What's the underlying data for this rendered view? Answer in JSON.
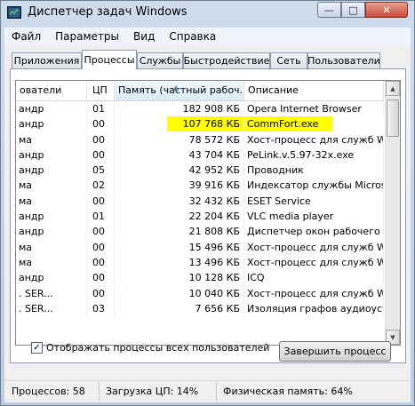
{
  "window": {
    "title": "Диспетчер задач Windows"
  },
  "caption_buttons": {
    "minimize": "—",
    "maximize": "□",
    "close": "✕"
  },
  "menu": [
    "Файл",
    "Параметры",
    "Вид",
    "Справка"
  ],
  "tabs": [
    {
      "label": "Приложения",
      "active": false
    },
    {
      "label": "Процессы",
      "active": true
    },
    {
      "label": "Службы",
      "active": false
    },
    {
      "label": "Быстродействие",
      "active": false
    },
    {
      "label": "Сеть",
      "active": false
    },
    {
      "label": "Пользователи",
      "active": false
    }
  ],
  "table": {
    "columns": {
      "user": "ователи",
      "cpu": "ЦП",
      "memory": "Память (частный рабоч...",
      "description": "Описание"
    },
    "sort_indicator": "▲",
    "rows": [
      {
        "user": "андр",
        "cpu": "01",
        "memory": "182 908 КБ",
        "description": "Opera Internet Browser",
        "highlighted": false
      },
      {
        "user": "андр",
        "cpu": "00",
        "memory": "107 768 КБ",
        "description": "CommFort.exe",
        "highlighted": true
      },
      {
        "user": "ма",
        "cpu": "00",
        "memory": "78 572 КБ",
        "description": "Хост-процесс для служб Windows",
        "highlighted": false
      },
      {
        "user": "андр",
        "cpu": "00",
        "memory": "43 704 КБ",
        "description": "PeLink.v.5.97-32x.exe",
        "highlighted": false
      },
      {
        "user": "андр",
        "cpu": "05",
        "memory": "42 952 КБ",
        "description": "Проводник",
        "highlighted": false
      },
      {
        "user": "ма",
        "cpu": "02",
        "memory": "39 916 КБ",
        "description": "Индексатор службы Microsoft Windows",
        "highlighted": false
      },
      {
        "user": "ма",
        "cpu": "00",
        "memory": "32 432 КБ",
        "description": "ESET Service",
        "highlighted": false
      },
      {
        "user": "андр",
        "cpu": "01",
        "memory": "22 204 КБ",
        "description": "VLC media player",
        "highlighted": false
      },
      {
        "user": "андр",
        "cpu": "00",
        "memory": "21 808 КБ",
        "description": "Диспетчер окон рабочего стола",
        "highlighted": false
      },
      {
        "user": "ма",
        "cpu": "00",
        "memory": "15 496 КБ",
        "description": "Хост-процесс для служб Windows",
        "highlighted": false
      },
      {
        "user": "ма",
        "cpu": "00",
        "memory": "13 496 КБ",
        "description": "Хост-процесс для служб Windows",
        "highlighted": false
      },
      {
        "user": "андр",
        "cpu": "00",
        "memory": "10 128 КБ",
        "description": "ICQ",
        "highlighted": false
      },
      {
        "user": ". SER...",
        "cpu": "00",
        "memory": "10 040 КБ",
        "description": "Хост-процесс для служб Windows",
        "highlighted": false
      },
      {
        "user": ". SER...",
        "cpu": "03",
        "memory": "7 656 КБ",
        "description": "Изоляция графов аудиоустройств",
        "highlighted": false
      }
    ]
  },
  "scrollbar": {
    "up": "▲",
    "down": "▼"
  },
  "show_all_processes": {
    "label": "Отображать процессы всех пользователей",
    "checked": true,
    "check_glyph": "✓"
  },
  "end_process_button": "Завершить процесс",
  "status": {
    "processes": "Процессов: 58",
    "cpu": "Загрузка ЦП: 14%",
    "memory": "Физическая память: 64%"
  },
  "colors": {
    "highlight": "#ffff00",
    "close_button": "#c84a36"
  }
}
